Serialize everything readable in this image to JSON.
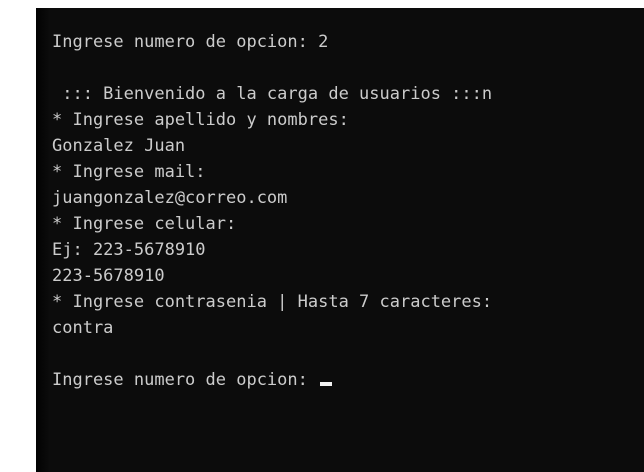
{
  "console": {
    "lines": [
      "Ingrese numero de opcion: 2",
      "",
      " ::: Bienvenido a la carga de usuarios :::n",
      "* Ingrese apellido y nombres:",
      "Gonzalez Juan",
      "* Ingrese mail:",
      "juangonzalez@correo.com",
      "* Ingrese celular:",
      "Ej: 223-5678910",
      "223-5678910",
      "* Ingrese contrasenia | Hasta 7 caracteres:",
      "contra",
      "",
      "Ingrese numero de opcion: "
    ],
    "text_color": "#cccccc",
    "background_color": "#0c0c0c",
    "cursor_icon": "block-cursor-icon"
  }
}
